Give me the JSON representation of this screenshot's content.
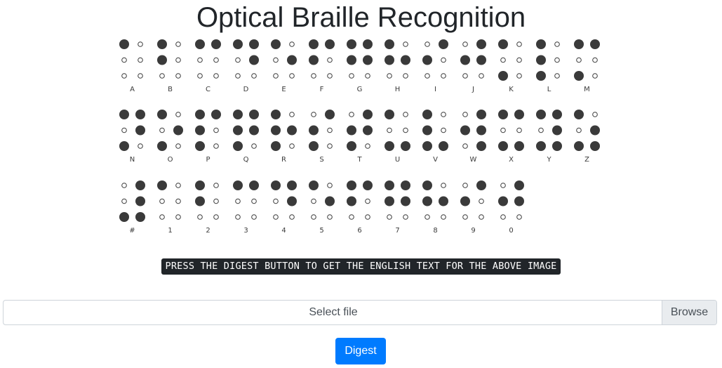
{
  "page": {
    "title": "Optical Braille Recognition"
  },
  "braille_chart": {
    "dot_color": "#3a3a3a",
    "rows": [
      [
        {
          "label": "A",
          "dots": [
            1
          ]
        },
        {
          "label": "B",
          "dots": [
            1,
            2
          ]
        },
        {
          "label": "C",
          "dots": [
            1,
            4
          ]
        },
        {
          "label": "D",
          "dots": [
            1,
            4,
            5
          ]
        },
        {
          "label": "E",
          "dots": [
            1,
            5
          ]
        },
        {
          "label": "F",
          "dots": [
            1,
            2,
            4
          ]
        },
        {
          "label": "G",
          "dots": [
            1,
            2,
            4,
            5
          ]
        },
        {
          "label": "H",
          "dots": [
            1,
            2,
            5
          ]
        },
        {
          "label": "I",
          "dots": [
            2,
            4
          ]
        },
        {
          "label": "J",
          "dots": [
            2,
            4,
            5
          ]
        },
        {
          "label": "K",
          "dots": [
            1,
            3
          ]
        },
        {
          "label": "L",
          "dots": [
            1,
            2,
            3
          ]
        },
        {
          "label": "M",
          "dots": [
            1,
            3,
            4
          ]
        }
      ],
      [
        {
          "label": "N",
          "dots": [
            1,
            3,
            4,
            5
          ]
        },
        {
          "label": "O",
          "dots": [
            1,
            3,
            5
          ]
        },
        {
          "label": "P",
          "dots": [
            1,
            2,
            3,
            4
          ]
        },
        {
          "label": "Q",
          "dots": [
            1,
            2,
            3,
            4,
            5
          ]
        },
        {
          "label": "R",
          "dots": [
            1,
            2,
            3,
            5
          ]
        },
        {
          "label": "S",
          "dots": [
            2,
            3,
            4
          ]
        },
        {
          "label": "T",
          "dots": [
            2,
            3,
            4,
            5
          ]
        },
        {
          "label": "U",
          "dots": [
            1,
            3,
            6
          ]
        },
        {
          "label": "V",
          "dots": [
            1,
            2,
            3,
            6
          ]
        },
        {
          "label": "W",
          "dots": [
            2,
            4,
            5,
            6
          ]
        },
        {
          "label": "X",
          "dots": [
            1,
            3,
            4,
            6
          ]
        },
        {
          "label": "Y",
          "dots": [
            1,
            3,
            4,
            5,
            6
          ]
        },
        {
          "label": "Z",
          "dots": [
            1,
            3,
            5,
            6
          ]
        }
      ],
      [
        {
          "label": "#",
          "dots": [
            3,
            4,
            5,
            6
          ]
        },
        {
          "label": "1",
          "dots": [
            1
          ]
        },
        {
          "label": "2",
          "dots": [
            1,
            2
          ]
        },
        {
          "label": "3",
          "dots": [
            1,
            4
          ]
        },
        {
          "label": "4",
          "dots": [
            1,
            4,
            5
          ]
        },
        {
          "label": "5",
          "dots": [
            1,
            5
          ]
        },
        {
          "label": "6",
          "dots": [
            1,
            2,
            4
          ]
        },
        {
          "label": "7",
          "dots": [
            1,
            2,
            4,
            5
          ]
        },
        {
          "label": "8",
          "dots": [
            1,
            2,
            5
          ]
        },
        {
          "label": "9",
          "dots": [
            2,
            4
          ]
        },
        {
          "label": "0",
          "dots": [
            2,
            4,
            5
          ]
        }
      ]
    ]
  },
  "caption": {
    "text": "PRESS THE DIGEST BUTTON TO GET THE ENGLISH TEXT FOR THE ABOVE IMAGE"
  },
  "file_input": {
    "label": "Select file",
    "browse_label": "Browse"
  },
  "digest": {
    "label": "Digest",
    "color": "#007bff"
  }
}
